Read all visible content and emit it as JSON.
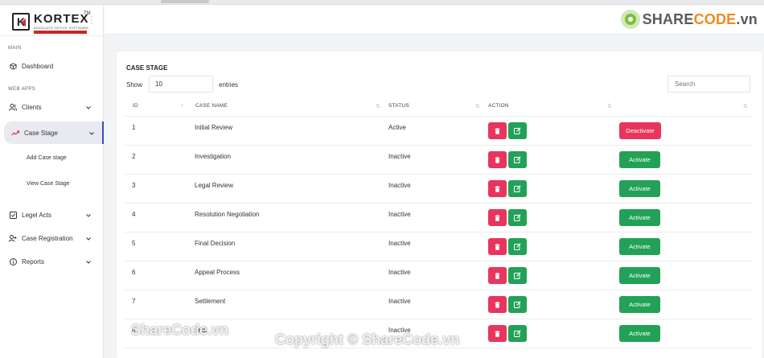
{
  "brand": {
    "name": "KORTEX",
    "tm": "TM",
    "tagline": "ADVOCATE OFFICE SOFTWARE",
    "byline": "by Mayuri K. Freelancer"
  },
  "sidebar": {
    "section_main": "MAIN",
    "section_webapps": "WEB APPS",
    "dashboard": "Dashboard",
    "clients": "Clients",
    "case_stage": "Case Stage",
    "add_case_stage": "Add Case stage",
    "view_case_stage": "View Case Stage",
    "legel_acts": "Legel Acts",
    "case_registration": "Case Registration",
    "reports": "Reports"
  },
  "header": {
    "badge_part1": "SHARE",
    "badge_part2": "CODE",
    "badge_part3": ".vn"
  },
  "table": {
    "title": "CASE STAGE",
    "show_label": "Show",
    "entries_value": "10",
    "entries_label": "entries",
    "search_placeholder": "Search",
    "columns": [
      "ID",
      "CASE NAME",
      "STATUS",
      "ACTION"
    ],
    "rows": [
      {
        "id": "1",
        "name": "Initial Review",
        "status": "Active",
        "toggle": "Deactivate"
      },
      {
        "id": "2",
        "name": "Investigation",
        "status": "Inactive",
        "toggle": "Activate"
      },
      {
        "id": "3",
        "name": "Legal Review",
        "status": "Inactive",
        "toggle": "Activate"
      },
      {
        "id": "4",
        "name": "Resolution Negotiation",
        "status": "Inactive",
        "toggle": "Activate"
      },
      {
        "id": "5",
        "name": "Final Decision",
        "status": "Inactive",
        "toggle": "Activate"
      },
      {
        "id": "6",
        "name": "Appeal Process",
        "status": "Inactive",
        "toggle": "Activate"
      },
      {
        "id": "7",
        "name": "Settlement",
        "status": "Inactive",
        "toggle": "Activate"
      },
      {
        "id": "8",
        "name": "Trial",
        "status": "Inactive",
        "toggle": "Activate"
      }
    ]
  },
  "watermarks": {
    "left": "ShareCode.vn",
    "center": "Copyright © ShareCode.vn"
  },
  "colors": {
    "danger": "#e8355d",
    "success": "#22a157",
    "accent": "#3b4cca"
  }
}
